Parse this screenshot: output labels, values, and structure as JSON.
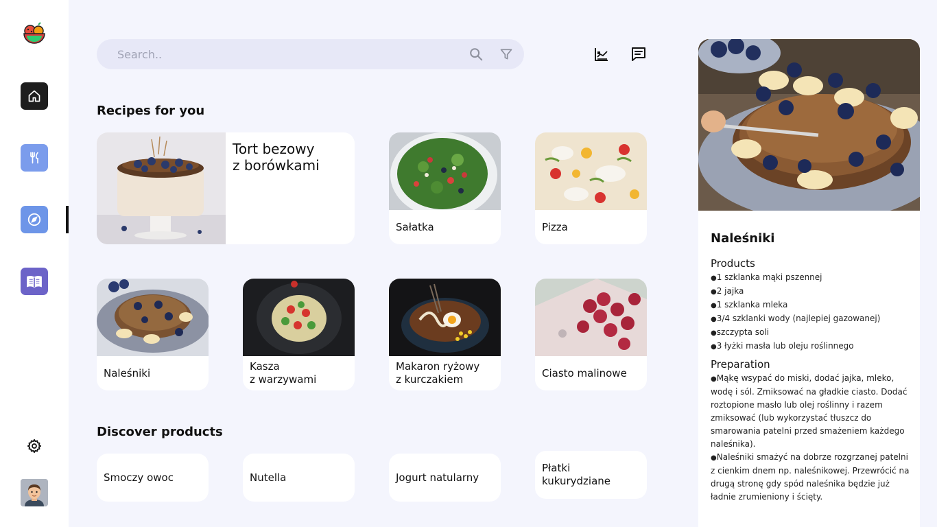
{
  "search": {
    "placeholder": "Search.."
  },
  "sections": {
    "recipes_title": "Recipes for you",
    "discover_title": "Discover products"
  },
  "recipes": [
    {
      "name": "Tort bezowy\nz borówkami"
    },
    {
      "name": "Sałatka"
    },
    {
      "name": "Pizza"
    },
    {
      "name": "Naleśniki"
    },
    {
      "name": "Kasza\nz warzywami"
    },
    {
      "name": "Makaron ryżowy\nz kurczakiem"
    },
    {
      "name": "Ciasto malinowe"
    }
  ],
  "products": [
    {
      "name": "Smoczy owoc"
    },
    {
      "name": "Nutella"
    },
    {
      "name": "Jogurt natularny"
    },
    {
      "name": "Płatki\nkukurydziane"
    }
  ],
  "detail": {
    "title": "Naleśniki",
    "products_title": "Products",
    "ingredients": [
      "1 szklanka mąki pszennej",
      "2 jajka",
      "1 szklanka mleka",
      "3/4 szklanki wody (najlepiej gazowanej)",
      "szczypta soli",
      "3 łyżki masła lub oleju roślinnego"
    ],
    "preparation_title": "Preparation",
    "steps": [
      "Mąkę wsypać do miski, dodać jajka, mleko, wodę i sól. Zmiksować na gładkie ciasto. Dodać roztopione masło lub olej roślinny i razem zmiksować (lub wykorzystać tłuszcz do smarowania patelni przed smażeniem każdego naleśnika).",
      "Naleśniki smażyć na dobrze rozgrzanej patelni z cienkim dnem np. naleśnikowej. Przewrócić na drugą stronę gdy spód naleśnika będzie już ładnie zrumieniony i ścięty."
    ]
  },
  "icons": {
    "logo": "fruit-bowl-icon",
    "home": "home-icon",
    "recipes": "cutlery-icon",
    "explore": "compass-icon",
    "book": "book-icon",
    "settings": "gear-icon",
    "search": "search-icon",
    "filter": "filter-icon",
    "chart": "chart-icon",
    "chat": "chat-icon"
  },
  "colors": {
    "background": "#f4f5fd",
    "sidebar": "#ffffff",
    "home_button": "#1e1e1e",
    "recipes_button": "#7b9cec",
    "explore_button": "#6d95e8",
    "book_button": "#6c63c8",
    "search_bg": "#e7e8f7"
  }
}
